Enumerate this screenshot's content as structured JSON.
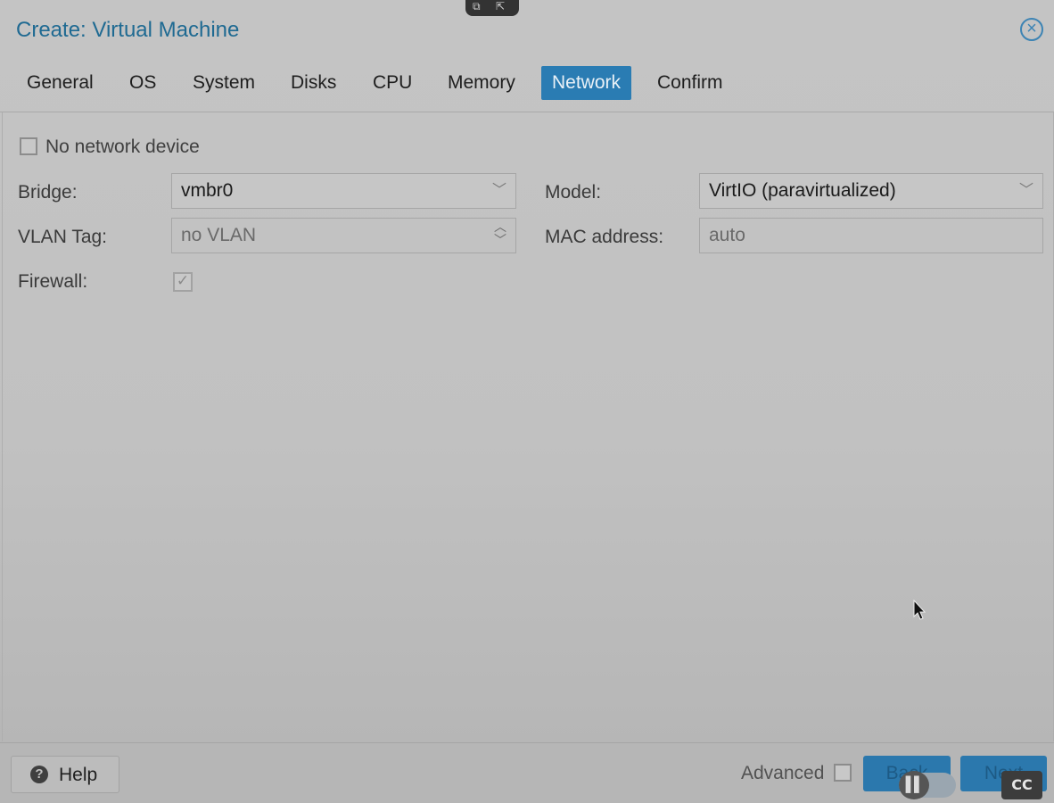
{
  "dialog": {
    "title": "Create: Virtual Machine",
    "close_symbol": "×"
  },
  "tabs": [
    {
      "label": "General",
      "active": false
    },
    {
      "label": "OS",
      "active": false
    },
    {
      "label": "System",
      "active": false
    },
    {
      "label": "Disks",
      "active": false
    },
    {
      "label": "CPU",
      "active": false
    },
    {
      "label": "Memory",
      "active": false
    },
    {
      "label": "Network",
      "active": true
    },
    {
      "label": "Confirm",
      "active": false
    }
  ],
  "network": {
    "no_network_device": {
      "label": "No network device",
      "checked": false
    },
    "bridge": {
      "label": "Bridge:",
      "value": "vmbr0"
    },
    "vlan_tag": {
      "label": "VLAN Tag:",
      "placeholder": "no VLAN"
    },
    "firewall": {
      "label": "Firewall:",
      "checked": true
    },
    "model": {
      "label": "Model:",
      "value": "VirtIO (paravirtualized)"
    },
    "mac_address": {
      "label": "MAC address:",
      "placeholder": "auto"
    }
  },
  "footer": {
    "help_label": "Help",
    "advanced_label": "Advanced",
    "advanced_checked": false,
    "back_label": "Back",
    "next_label": "Next"
  },
  "player_overlay": {
    "cc_label": "CC"
  },
  "colors": {
    "accent": "#2a7cb3",
    "title": "#1f6a92"
  }
}
